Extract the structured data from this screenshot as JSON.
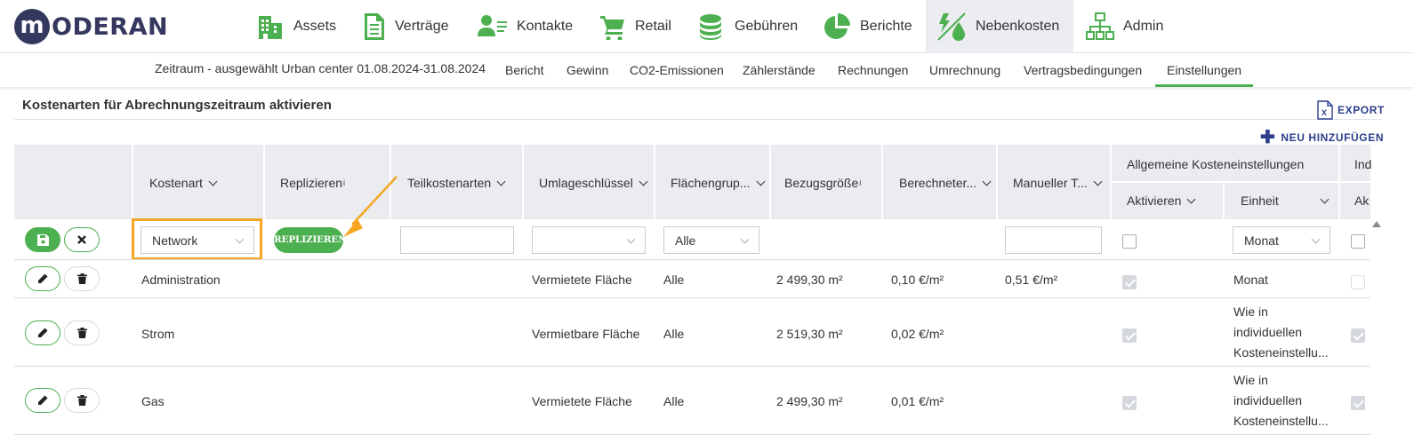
{
  "brand": {
    "logo_letter": "m",
    "logo_text": "ODERAN"
  },
  "topnav": [
    {
      "label": "Assets",
      "icon": "building-icon"
    },
    {
      "label": "Verträge",
      "icon": "document-icon"
    },
    {
      "label": "Kontakte",
      "icon": "contacts-icon"
    },
    {
      "label": "Retail",
      "icon": "cart-icon"
    },
    {
      "label": "Gebühren",
      "icon": "coins-icon"
    },
    {
      "label": "Berichte",
      "icon": "pie-chart-icon"
    },
    {
      "label": "Nebenkosten",
      "icon": "utilities-icon",
      "active": true
    },
    {
      "label": "Admin",
      "icon": "org-chart-icon"
    }
  ],
  "subnav": {
    "zeitraum": "Zeitraum - ausgewählt Urban center 01.08.2024-31.08.2024",
    "tabs": [
      "Bericht",
      "Gewinn",
      "CO2-Emissionen",
      "Zählerstände",
      "Rechnungen",
      "Umrechnung",
      "Vertragsbedingungen",
      "Einstellungen"
    ],
    "active_tab": "Einstellungen"
  },
  "section": {
    "title": "Kostenarten für Abrechnungszeitraum aktivieren",
    "export_label": "EXPORT",
    "add_label": "NEU HINZUFÜGEN"
  },
  "table": {
    "headers": {
      "kostenart": "Kostenart",
      "replizieren": "Replizieren",
      "info_mark": "i",
      "teilkostenarten": "Teilkostenarten",
      "umlageschluessel": "Umlageschlüssel",
      "flaechengruppe": "Flächengrup...",
      "bezugsgroesse": "Bezugsgröße",
      "berechneter": "Berechneter...",
      "manueller": "Manueller T...",
      "allgemeine": "Allgemeine Kosteneinstellungen",
      "aktivieren": "Aktivieren",
      "einheit": "Einheit",
      "ind": "Ind",
      "ak": "Ak"
    },
    "edit_row": {
      "kostenart_value": "Network",
      "replicate_button": "REPLIZIEREN",
      "flaechengruppe_value": "Alle",
      "einheit_value": "Monat"
    },
    "rows": [
      {
        "kostenart": "Administration",
        "umlageschluessel": "Vermietete Fläche",
        "flaechengruppe": "Alle",
        "bezugsgroesse": "2 499,30 m²",
        "berechneter": "0,10 €/m²",
        "manueller": "0,51 €/m²",
        "aktivieren": true,
        "einheit": [
          "Monat"
        ],
        "ind_aktiv": false
      },
      {
        "kostenart": "Strom",
        "umlageschluessel": "Vermietbare Fläche",
        "flaechengruppe": "Alle",
        "bezugsgroesse": "2 519,30 m²",
        "berechneter": "0,02 €/m²",
        "manueller": "",
        "aktivieren": true,
        "einheit": [
          "Wie in",
          "individuellen",
          "Kosteneinstellu..."
        ],
        "ind_aktiv": true
      },
      {
        "kostenart": "Gas",
        "umlageschluessel": "Vermietete Fläche",
        "flaechengruppe": "Alle",
        "bezugsgroesse": "2 499,30 m²",
        "berechneter": "0,01 €/m²",
        "manueller": "",
        "aktivieren": true,
        "einheit": [
          "Wie in",
          "individuellen",
          "Kosteneinstellu..."
        ],
        "ind_aktiv": true
      }
    ]
  },
  "colors": {
    "green": "#4caf50",
    "navy": "#2d3e8c",
    "logo": "#34385e",
    "highlight": "#f5a623"
  }
}
